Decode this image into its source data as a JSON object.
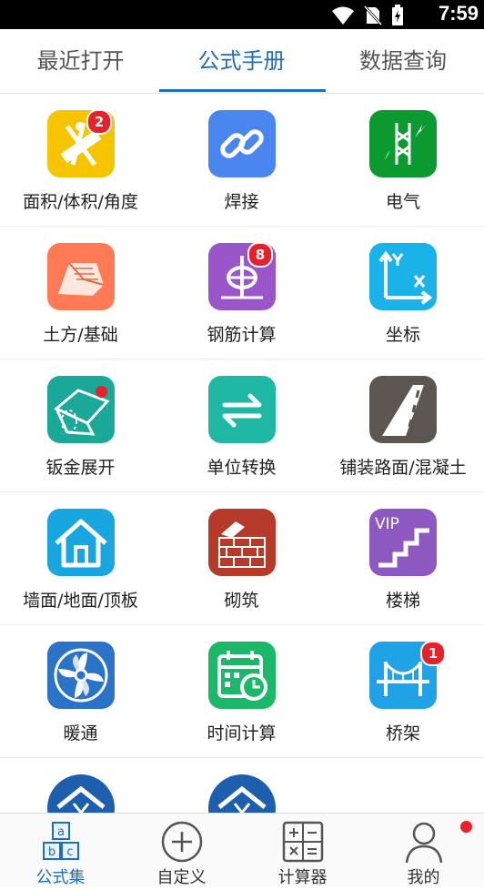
{
  "status_bar": {
    "time": "7:59"
  },
  "tabs": [
    {
      "label": "最近打开"
    },
    {
      "label": "公式手册"
    },
    {
      "label": "数据查询"
    }
  ],
  "active_tab": "公式手册",
  "items": [
    {
      "label": "面积/体积/角度",
      "icon": "ruler-compass-icon",
      "color": "#f7c400",
      "badge": "2"
    },
    {
      "label": "焊接",
      "icon": "chain-link-icon",
      "color": "#4a86f0"
    },
    {
      "label": "电气",
      "icon": "electric-tower-icon",
      "color": "#0a9a2f"
    },
    {
      "label": "土方/基础",
      "icon": "earthwork-icon",
      "color": "#ff7a55"
    },
    {
      "label": "钢筋计算",
      "icon": "rebar-icon",
      "color": "#9a56c8",
      "badge": "8"
    },
    {
      "label": "坐标",
      "icon": "xy-axis-icon",
      "color": "#19b3ea"
    },
    {
      "label": "钣金展开",
      "icon": "sheet-metal-icon",
      "color": "#1aa898",
      "dot": true
    },
    {
      "label": "单位转换",
      "icon": "swap-arrows-icon",
      "color": "#1fb8a4"
    },
    {
      "label": "铺装路面/混凝土",
      "icon": "road-icon",
      "color": "#5d5550"
    },
    {
      "label": "墙面/地面/顶板",
      "icon": "house-icon",
      "color": "#18a6e0"
    },
    {
      "label": "砌筑",
      "icon": "brick-wall-icon",
      "color": "#b53a2a"
    },
    {
      "label": "楼梯",
      "icon": "stairs-vip-icon",
      "color": "#8d58c0",
      "vip": "VIP"
    },
    {
      "label": "暖通",
      "icon": "fan-icon",
      "color": "#2a73c8"
    },
    {
      "label": "时间计算",
      "icon": "calendar-clock-icon",
      "color": "#1cb86a"
    },
    {
      "label": "桥架",
      "icon": "bridge-icon",
      "color": "#1fa2e6",
      "badge": "1"
    },
    {
      "label": "",
      "icon": "house-yen-icon",
      "color": "#1d5fae"
    },
    {
      "label": "",
      "icon": "house-yen-icon",
      "color": "#1d5fae"
    }
  ],
  "bottom_nav": [
    {
      "label": "公式集",
      "icon": "abc-blocks-icon",
      "active": true
    },
    {
      "label": "自定义",
      "icon": "plus-circle-icon"
    },
    {
      "label": "计算器",
      "icon": "calculator-icon"
    },
    {
      "label": "我的",
      "icon": "person-icon",
      "dot": true
    }
  ]
}
